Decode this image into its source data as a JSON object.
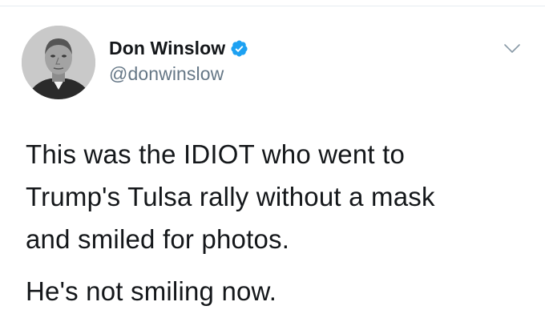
{
  "tweet": {
    "author": {
      "display_name": "Don Winslow",
      "handle": "@donwinslow",
      "verified": true,
      "avatar_icon": "profile-photo"
    },
    "menu_icon": "chevron-down-icon",
    "text": {
      "line1": "This was the IDIOT who went to",
      "line2": "Trump's Tulsa rally without a mask",
      "line3": "and smiled for photos.",
      "line4": "He's not smiling now."
    }
  },
  "colors": {
    "verified_blue": "#1da1f2",
    "handle_gray": "#657786",
    "text_dark": "#14171a",
    "divider": "#e6ecf0"
  }
}
